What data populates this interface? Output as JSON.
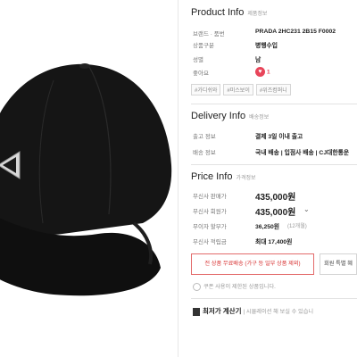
{
  "product_info": {
    "title": "Product Info",
    "subtitle": "제품정보",
    "rows": [
      {
        "label": "브랜드 · 품번",
        "value": "PRADA  2HC231 2B15 F0002"
      },
      {
        "label": "상품구분",
        "value": "병행수입"
      },
      {
        "label": "성별",
        "value": "남"
      },
      {
        "label": "좋아요",
        "value": "1"
      }
    ],
    "tags": [
      "#가디쉬와",
      "#미스보이",
      "#위즈컴퍼니"
    ]
  },
  "delivery_info": {
    "title": "Delivery Info",
    "subtitle": "배송정보",
    "rows": [
      {
        "label": "출고 정보",
        "value": "결제 3일 이내 출고"
      },
      {
        "label": "배송 정보",
        "value": "국내 배송 | 입점사 배송 | CJ대한통운"
      }
    ]
  },
  "price_info": {
    "title": "Price Info",
    "subtitle": "가격정보",
    "rows": [
      {
        "label": "무신사 판매가",
        "value": "435,000원"
      },
      {
        "label": "무신사 회원가",
        "value": "435,000원"
      },
      {
        "label": "무이자 할부가",
        "value": "36,250원",
        "note": "(12개월)"
      },
      {
        "label": "무신사 적립금",
        "value": "최대 17,400원"
      }
    ],
    "expand_icon": "chevron-down-icon"
  },
  "buttons": {
    "free_shipping": "전 상품 무료배송 (가구 등 일부 상품 제외)",
    "member_benefit": "회원 특별 혜"
  },
  "coupon_notice": "쿠폰 사용이 제한된 상품입니다.",
  "calculator": {
    "title": "최저가 계산기",
    "desc": "| 시뮬레이션 해 보실 수 있습니"
  },
  "colors": {
    "accent_red": "#e36b6b",
    "heart": "#e8455a"
  }
}
